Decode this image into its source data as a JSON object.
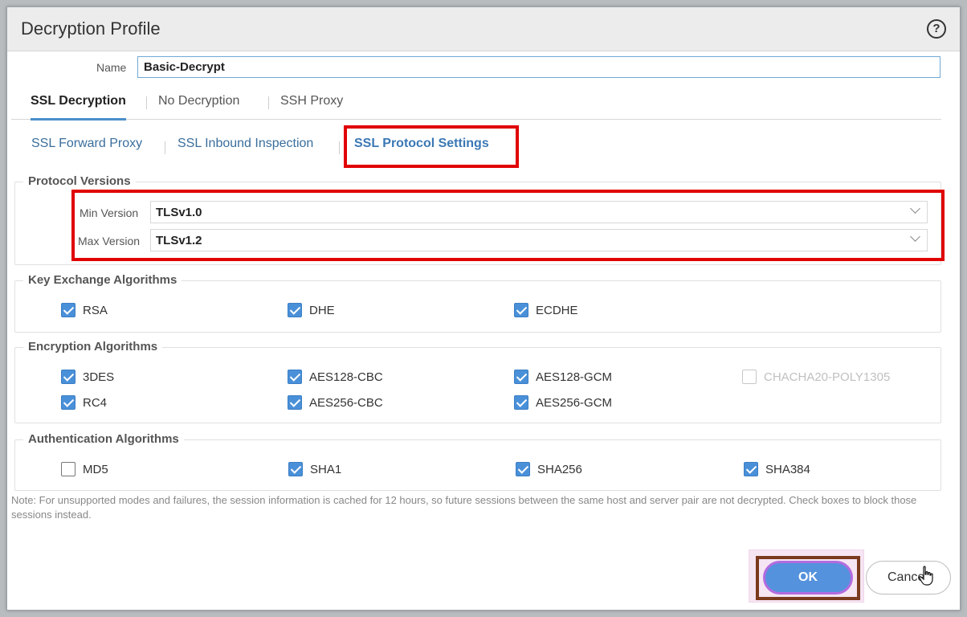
{
  "dialog": {
    "title": "Decryption Profile",
    "help_icon": "help-circle-icon"
  },
  "name": {
    "label": "Name",
    "value": "Basic-Decrypt"
  },
  "tabs": [
    {
      "label": "SSL Decryption",
      "active": true
    },
    {
      "label": "No Decryption",
      "active": false
    },
    {
      "label": "SSH Proxy",
      "active": false
    }
  ],
  "subtabs": [
    {
      "label": "SSL Forward Proxy",
      "active": false
    },
    {
      "label": "SSL Inbound Inspection",
      "active": false
    },
    {
      "label": "SSL Protocol Settings",
      "active": true
    }
  ],
  "protocol_versions": {
    "legend": "Protocol Versions",
    "min": {
      "label": "Min Version",
      "value": "TLSv1.0"
    },
    "max": {
      "label": "Max Version",
      "value": "TLSv1.2"
    }
  },
  "key_exchange": {
    "legend": "Key Exchange Algorithms",
    "items": [
      {
        "label": "RSA",
        "checked": true
      },
      {
        "label": "DHE",
        "checked": true
      },
      {
        "label": "ECDHE",
        "checked": true
      }
    ]
  },
  "encryption": {
    "legend": "Encryption Algorithms",
    "items": [
      {
        "label": "3DES",
        "checked": true
      },
      {
        "label": "AES128-CBC",
        "checked": true
      },
      {
        "label": "AES128-GCM",
        "checked": true
      },
      {
        "label": "CHACHA20-POLY1305",
        "checked": false,
        "disabled": true
      },
      {
        "label": "RC4",
        "checked": true
      },
      {
        "label": "AES256-CBC",
        "checked": true
      },
      {
        "label": "AES256-GCM",
        "checked": true
      }
    ]
  },
  "authentication": {
    "legend": "Authentication Algorithms",
    "items": [
      {
        "label": "MD5",
        "checked": false
      },
      {
        "label": "SHA1",
        "checked": true
      },
      {
        "label": "SHA256",
        "checked": true
      },
      {
        "label": "SHA384",
        "checked": true
      }
    ]
  },
  "note": "Note: For unsupported modes and failures, the session information is cached for 12 hours, so future sessions between the same host and server pair are not decrypted. Check boxes to block those sessions instead.",
  "buttons": {
    "ok": "OK",
    "cancel": "Cancel"
  },
  "colors": {
    "accent": "#4a90d9",
    "highlight": "#e00000",
    "ok_button": "#5592dd"
  }
}
